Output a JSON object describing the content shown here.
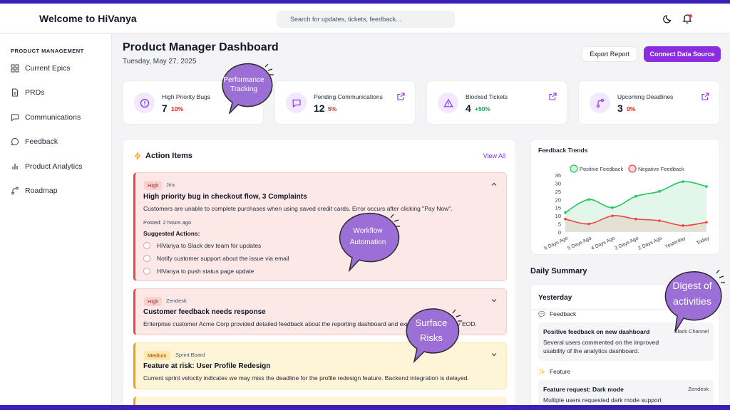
{
  "header": {
    "brand": "Welcome to HiVanya",
    "search_placeholder": "Search for updates, tickets, feedback...",
    "icons": [
      "moon-icon",
      "bell-icon"
    ]
  },
  "sidebar": {
    "section_title": "PRODUCT MANAGEMENT",
    "items": [
      {
        "label": "Current Epics",
        "icon": "grid-icon"
      },
      {
        "label": "PRDs",
        "icon": "document-icon"
      },
      {
        "label": "Communications",
        "icon": "chat-icon"
      },
      {
        "label": "Feedback",
        "icon": "message-circle-icon"
      },
      {
        "label": "Product Analytics",
        "icon": "bar-chart-icon"
      },
      {
        "label": "Roadmap",
        "icon": "route-icon"
      }
    ]
  },
  "main": {
    "title": "Product Manager Dashboard",
    "date": "Tuesday, May 27, 2025",
    "export_label": "Export Report",
    "connect_label": "Connect Data Source"
  },
  "stats": [
    {
      "label": "High Priority Bugs",
      "value": "7",
      "change": "10%",
      "change_color": "#dc2626",
      "icon": "alert-circle-icon",
      "has_link": false
    },
    {
      "label": "Pending Communications",
      "value": "12",
      "change": "5%",
      "change_color": "#dc2626",
      "icon": "chat-icon",
      "has_link": true
    },
    {
      "label": "Blocked Tickets",
      "value": "4",
      "change": "+50%",
      "change_color": "#16a34a",
      "icon": "warning-icon",
      "has_link": true
    },
    {
      "label": "Upcoming Deadlines",
      "value": "3",
      "change": "0%",
      "change_color": "#dc2626",
      "icon": "route-icon",
      "has_link": true
    }
  ],
  "action_items": {
    "title": "Action Items",
    "view_all": "View All",
    "cards": [
      {
        "priority": "High",
        "source": "Jira",
        "title": "High priority bug in checkout flow, 3 Complaints",
        "desc": "Customers are unable to complete purchases when using saved credit cards. Error occurs after clicking \"Pay Now\".",
        "posted": "Posted: 2 hours ago",
        "suggested_label": "Suggested Actions:",
        "actions": [
          "HiVanya to Slack dev team for updates",
          "Notify customer support about the issue via email",
          "HiVanya to push status page update"
        ]
      },
      {
        "priority": "High",
        "source": "Zendesk",
        "title": "Customer feedback needs response",
        "desc": "Enterprise customer Acme Corp provided detailed feedback about the reporting dashboard and expects a response by EOD."
      },
      {
        "priority": "Medium",
        "source": "Sprint Board",
        "title": "Feature at risk: User Profile Redesign",
        "desc": "Current sprint velocity indicates we may miss the deadline for the profile redesign feature. Backend integration is delayed."
      }
    ]
  },
  "chart_data": {
    "type": "line",
    "title": "Feedback Trends",
    "categories": [
      "6 Days Ago",
      "5 Days Ago",
      "4 Days Ago",
      "3 Days Ago",
      "2 Days Ago",
      "Yesterday",
      "Today"
    ],
    "series": [
      {
        "name": "Positive Feedback",
        "values": [
          12,
          20,
          15,
          22,
          25,
          31,
          28
        ],
        "color": "#22c55e"
      },
      {
        "name": "Negative Feedback",
        "values": [
          8,
          5,
          10,
          8,
          7,
          4,
          6
        ],
        "color": "#ef4444"
      }
    ],
    "yticks": [
      0,
      5,
      10,
      15,
      20,
      25,
      30,
      35
    ],
    "ylim": [
      0,
      35
    ],
    "legend": "top",
    "grid": false
  },
  "daily_summary": {
    "title": "Daily Summary",
    "day": "Yesterday",
    "sections": [
      {
        "label": "Feedback",
        "icon": "speech-bubble-icon",
        "item_title": "Positive feedback on new dashboard",
        "item_source": "Slack Channel",
        "item_desc": "Several users commented on the improved usability of the analytics dashboard."
      },
      {
        "label": "Feature",
        "icon": "sparkle-icon",
        "item_title": "Feature request: Dark mode",
        "item_source": "Zendesk",
        "item_desc": "Multiple users requested dark mode support"
      }
    ]
  },
  "callouts": {
    "performance": [
      "Performance",
      "Tracking"
    ],
    "workflow": [
      "Workflow",
      "Automation"
    ],
    "risks": [
      "Surface",
      "Risks"
    ],
    "digest": [
      "Digest of",
      "activities"
    ],
    "bubble_color": "#9b6fd6"
  }
}
